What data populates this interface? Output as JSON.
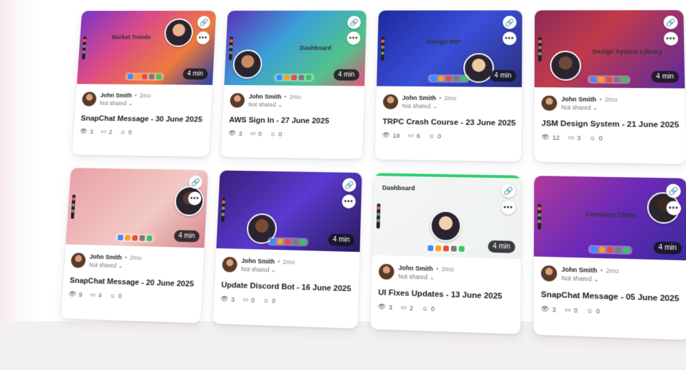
{
  "cards": [
    {
      "title": "SnapChat Message - 30 June 2025",
      "author": "John Smith",
      "age": "2mo",
      "share": "Not shared",
      "views": "3",
      "comments": "2",
      "reactions": "0",
      "duration": "4 min",
      "thumb_label": "Market Trends",
      "bg": "linear-gradient(135deg,#7a35c9 0%,#d84a8a 35%,#ef7b3e 70%,#2a3fa6 100%)"
    },
    {
      "title": "AWS Sign In - 27 June 2025",
      "author": "John Smith",
      "age": "2mo",
      "share": "Not shared",
      "views": "3",
      "comments": "0",
      "reactions": "0",
      "duration": "4 min",
      "thumb_label": "Dashboard",
      "bg": "linear-gradient(135deg,#5a32b8 0%,#3aa0d8 40%,#52c28a 75%,#e1547c 100%)"
    },
    {
      "title": "TRPC Crash Course - 23 June 2025",
      "author": "John Smith",
      "age": "2mo",
      "share": "Not shared",
      "views": "19",
      "comments": "6",
      "reactions": "0",
      "duration": "4 min",
      "thumb_label": "Design WIP",
      "bg": "linear-gradient(135deg,#1f2a9e 0%,#3a4fd8 50%,#2a2f7a 100%)"
    },
    {
      "title": "JSM Design System - 21 June 2025",
      "author": "John Smith",
      "age": "2mo",
      "share": "Not shared",
      "views": "12",
      "comments": "3",
      "reactions": "0",
      "duration": "4 min",
      "thumb_label": "Design System Library",
      "bg": "linear-gradient(135deg,#8a2a5a 0%,#c23a4a 40%,#5a2aa0 100%)"
    },
    {
      "title": "SnapChat Message - 20 June 2025",
      "author": "John Smith",
      "age": "2mo",
      "share": "Not shared",
      "views": "9",
      "comments": "4",
      "reactions": "0",
      "duration": "4 min",
      "thumb_label": "",
      "bg": "linear-gradient(135deg,#e8a0a8 0%,#f2c9c4 60%,#d7878f 100%)"
    },
    {
      "title": "Update Discord Bot - 16 June 2025",
      "author": "John Smith",
      "age": "2mo",
      "share": "Not shared",
      "views": "3",
      "comments": "0",
      "reactions": "0",
      "duration": "4 min",
      "thumb_label": "",
      "bg": "linear-gradient(135deg,#3a1f7a 0%,#5a3ad0 50%,#2a1a5a 100%)"
    },
    {
      "title": "UI Fixes Updates - 13 June 2025",
      "author": "John Smith",
      "age": "2mo",
      "share": "Not shared",
      "views": "3",
      "comments": "2",
      "reactions": "0",
      "duration": "4 min",
      "thumb_label": "Dashboard",
      "bg": "linear-gradient(135deg,#f4f6f5 0%,#eef2ef 100%)"
    },
    {
      "title": "SnapChat Message - 05 June 2025",
      "author": "John Smith",
      "age": "2mo",
      "share": "Not shared",
      "views": "3",
      "comments": "0",
      "reactions": "0",
      "duration": "4 min",
      "thumb_label": "Company OKRs",
      "bg": "linear-gradient(135deg,#b03a9a 0%,#6a2ab8 50%,#3a2a9a 100%)"
    }
  ],
  "icons": {
    "link": "link-icon",
    "more": "more-icon",
    "views": "eye-icon",
    "comments": "comment-icon",
    "reactions": "smile-icon",
    "chevron": "chevron-down-icon"
  }
}
